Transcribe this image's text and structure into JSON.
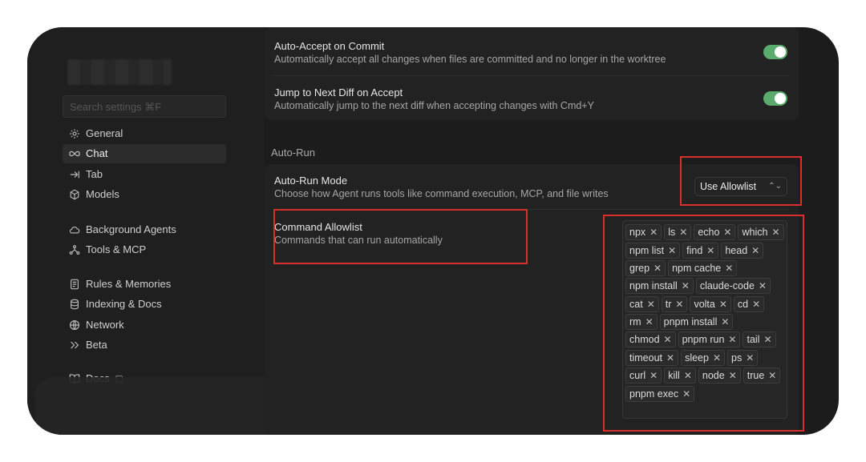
{
  "sidebar": {
    "search_placeholder": "Search settings ⌘F",
    "groups": [
      [
        {
          "label": "General",
          "icon": "gear-icon",
          "active": false
        },
        {
          "label": "Chat",
          "icon": "infinity-icon",
          "active": true
        },
        {
          "label": "Tab",
          "icon": "arrow-right-icon",
          "active": false
        },
        {
          "label": "Models",
          "icon": "cube-icon",
          "active": false
        }
      ],
      [
        {
          "label": "Background Agents",
          "icon": "cloud-icon",
          "active": false
        },
        {
          "label": "Tools & MCP",
          "icon": "network-nodes-icon",
          "active": false
        }
      ],
      [
        {
          "label": "Rules & Memories",
          "icon": "document-icon",
          "active": false
        },
        {
          "label": "Indexing & Docs",
          "icon": "database-icon",
          "active": false
        },
        {
          "label": "Network",
          "icon": "globe-icon",
          "active": false
        },
        {
          "label": "Beta",
          "icon": "double-chevron-icon",
          "active": false
        }
      ],
      [
        {
          "label": "Docs",
          "icon": "book-icon",
          "active": false,
          "external": true
        }
      ]
    ]
  },
  "settings": {
    "auto_accept": {
      "title": "Auto-Accept on Commit",
      "desc": "Automatically accept all changes when files are committed and no longer in the worktree",
      "enabled": true
    },
    "jump_next_diff": {
      "title": "Jump to Next Diff on Accept",
      "desc": "Automatically jump to the next diff when accepting changes with Cmd+Y",
      "enabled": true
    },
    "auto_run_section": "Auto-Run",
    "auto_run_mode": {
      "title": "Auto-Run Mode",
      "desc": "Choose how Agent runs tools like command execution, MCP, and file writes",
      "value": "Use Allowlist"
    },
    "command_allowlist": {
      "title": "Command Allowlist",
      "desc": "Commands that can run automatically",
      "commands": [
        "npx",
        "ls",
        "echo",
        "which",
        "npm list",
        "find",
        "head",
        "grep",
        "npm cache",
        "npm install",
        "claude-code",
        "cat",
        "tr",
        "volta",
        "cd",
        "rm",
        "pnpm install",
        "chmod",
        "pnpm run",
        "tail",
        "timeout",
        "sleep",
        "ps",
        "curl",
        "kill",
        "node",
        "true",
        "pnpm exec"
      ]
    }
  },
  "colors": {
    "toggle_on": "#5cab6e",
    "highlight_red": "#d9302c",
    "background": "#1c1c1c"
  }
}
